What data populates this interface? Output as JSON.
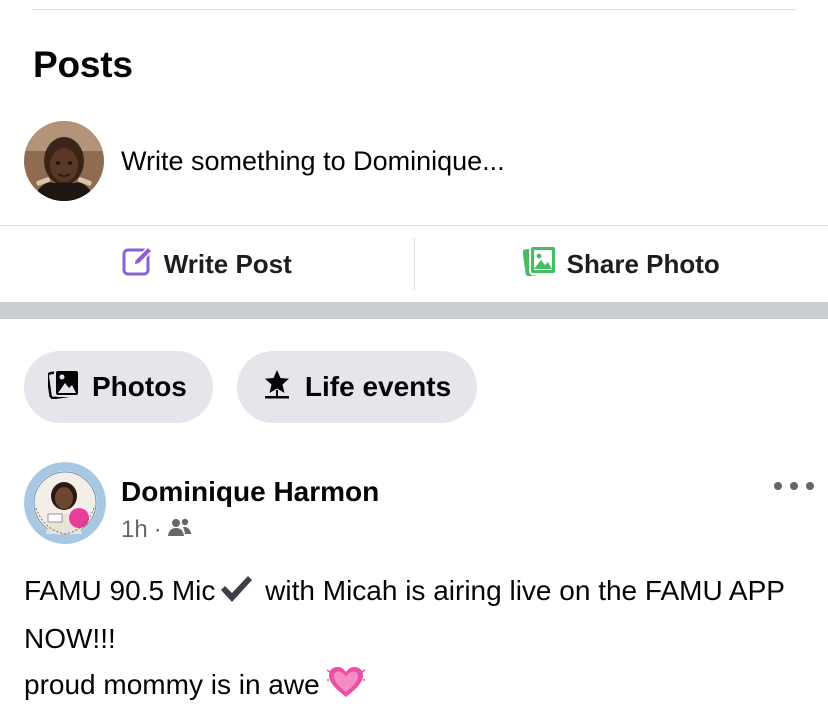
{
  "posts_section": {
    "heading": "Posts",
    "composer_prompt": "Write something to Dominique...",
    "write_post_label": "Write Post",
    "share_photo_label": "Share Photo"
  },
  "filters": {
    "photos_label": "Photos",
    "life_events_label": "Life events"
  },
  "post": {
    "author": "Dominique Harmon",
    "time": "1h",
    "separator": "·",
    "audience_icon": "friends-icon",
    "line1_a": "FAMU 90.5 Mic",
    "line1_b": " with Micah is airing live on the FAMU APP NOW!!!",
    "line2": "proud mommy is in awe",
    "emoji_check": "heavy-check-mark",
    "emoji_heart": "beating-heart"
  },
  "colors": {
    "write_post_icon": "#8a63d2",
    "share_photo_icon": "#45bd62",
    "chip_bg": "#e4e6eb",
    "section_gap": "#c9ccd1",
    "heart": "#ec4fa6"
  }
}
